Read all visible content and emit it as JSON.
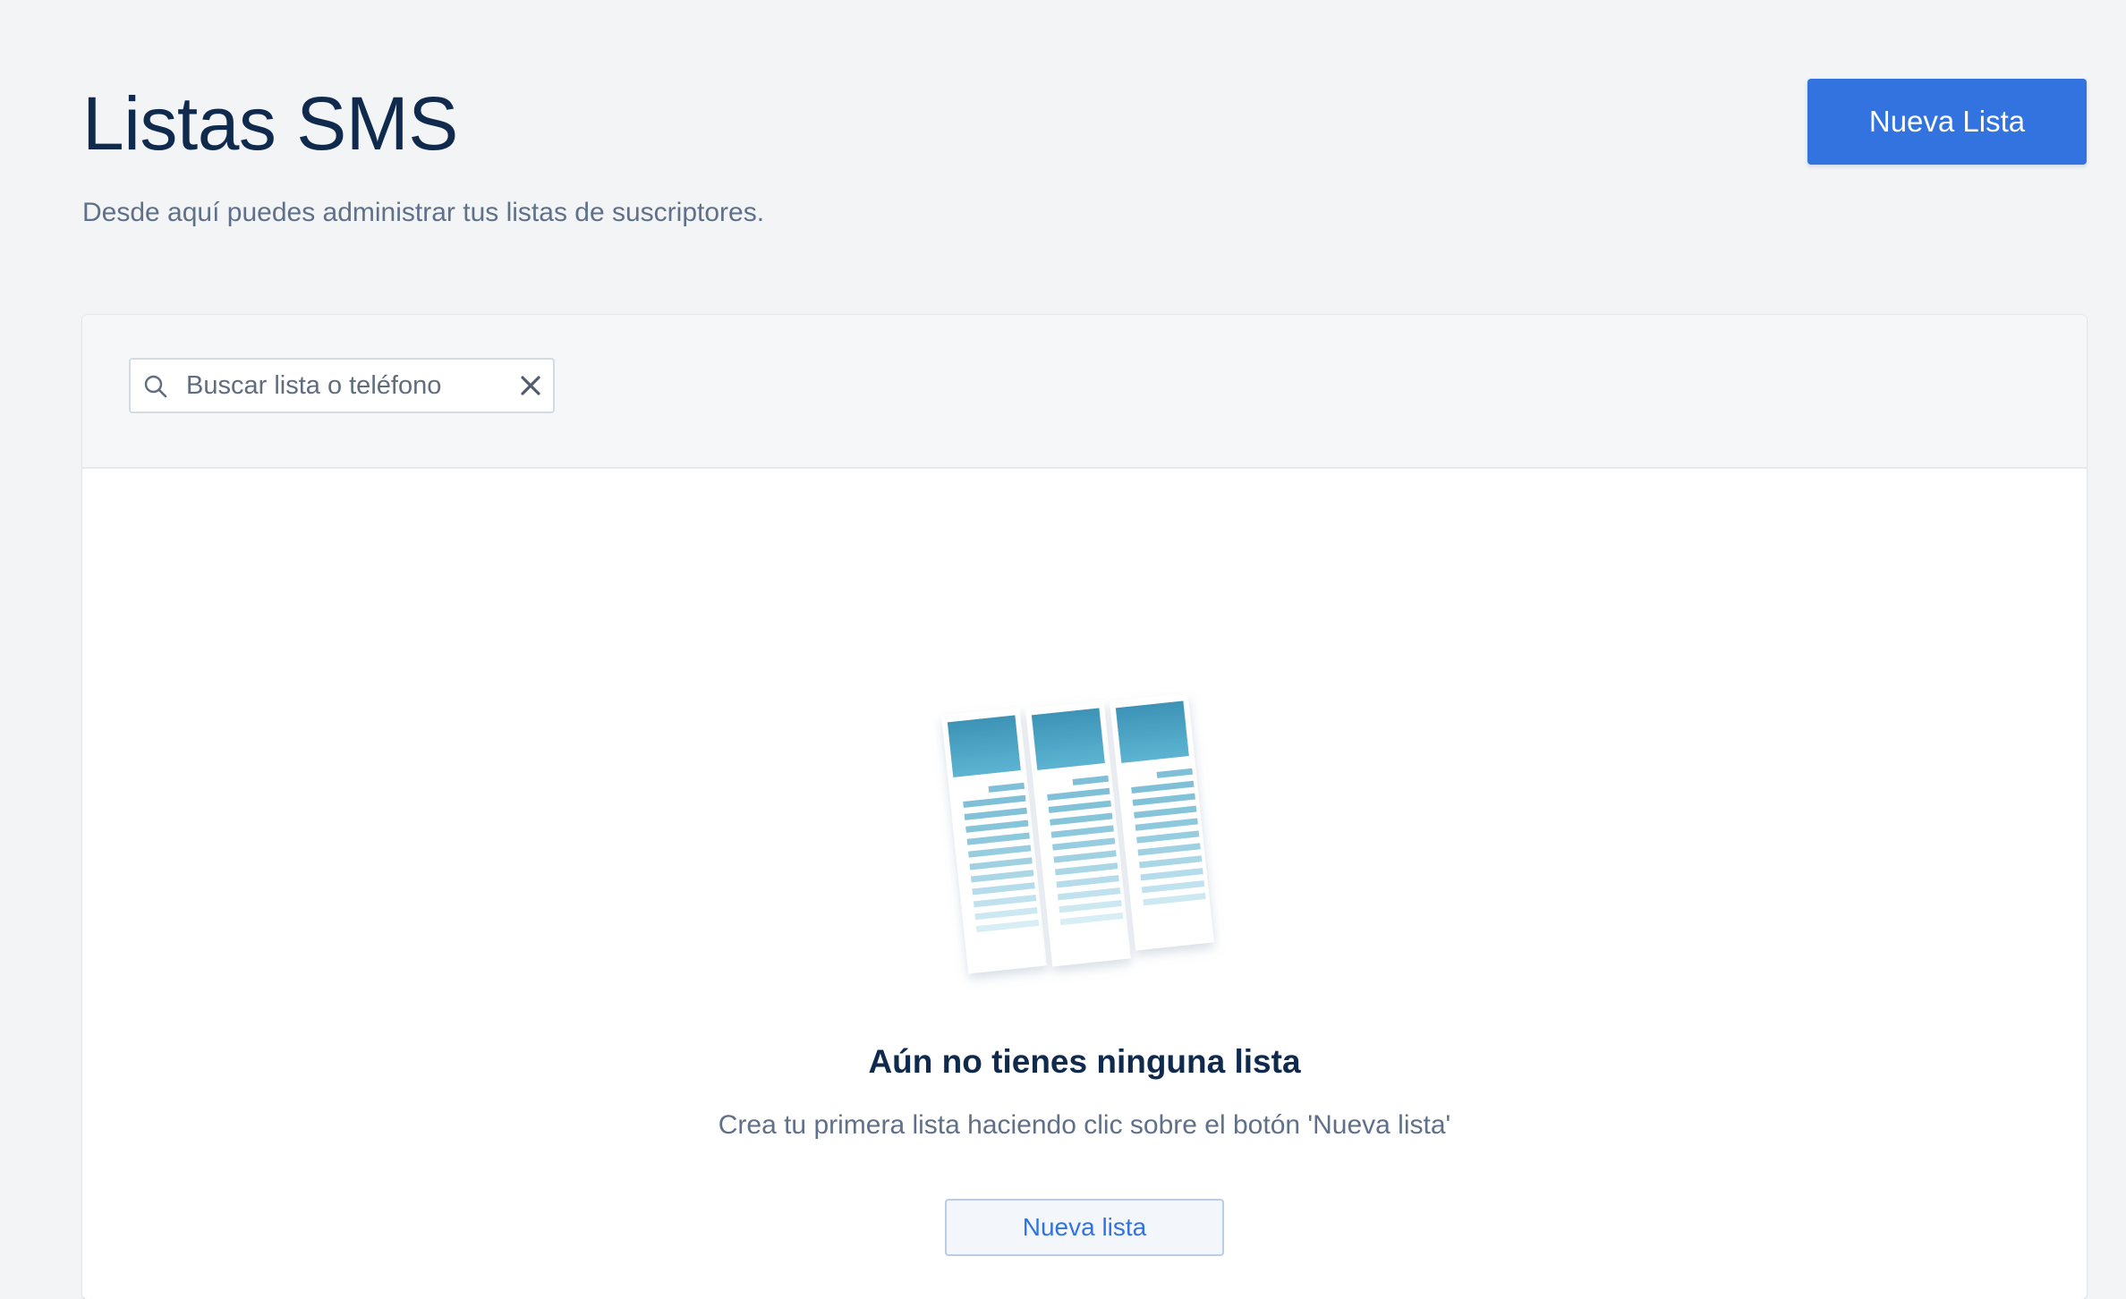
{
  "header": {
    "title": "Listas SMS",
    "subtitle": "Desde aquí puedes administrar tus listas de suscriptores.",
    "new_list_label": "Nueva Lista"
  },
  "search": {
    "placeholder": "Buscar lista o teléfono",
    "value": "",
    "search_icon": "search-icon",
    "clear_icon": "close-icon"
  },
  "empty_state": {
    "illustration": "lists-illustration",
    "title": "Aún no tienes ninguna lista",
    "text": "Crea tu primera lista haciendo clic sobre el botón 'Nueva lista'",
    "button_label": "Nueva lista"
  },
  "colors": {
    "accent": "#3273e0",
    "background": "#f2f4f6",
    "title": "#0f2a4d",
    "muted_text": "#5f7088",
    "illustration_header": "#4aa3c4"
  }
}
